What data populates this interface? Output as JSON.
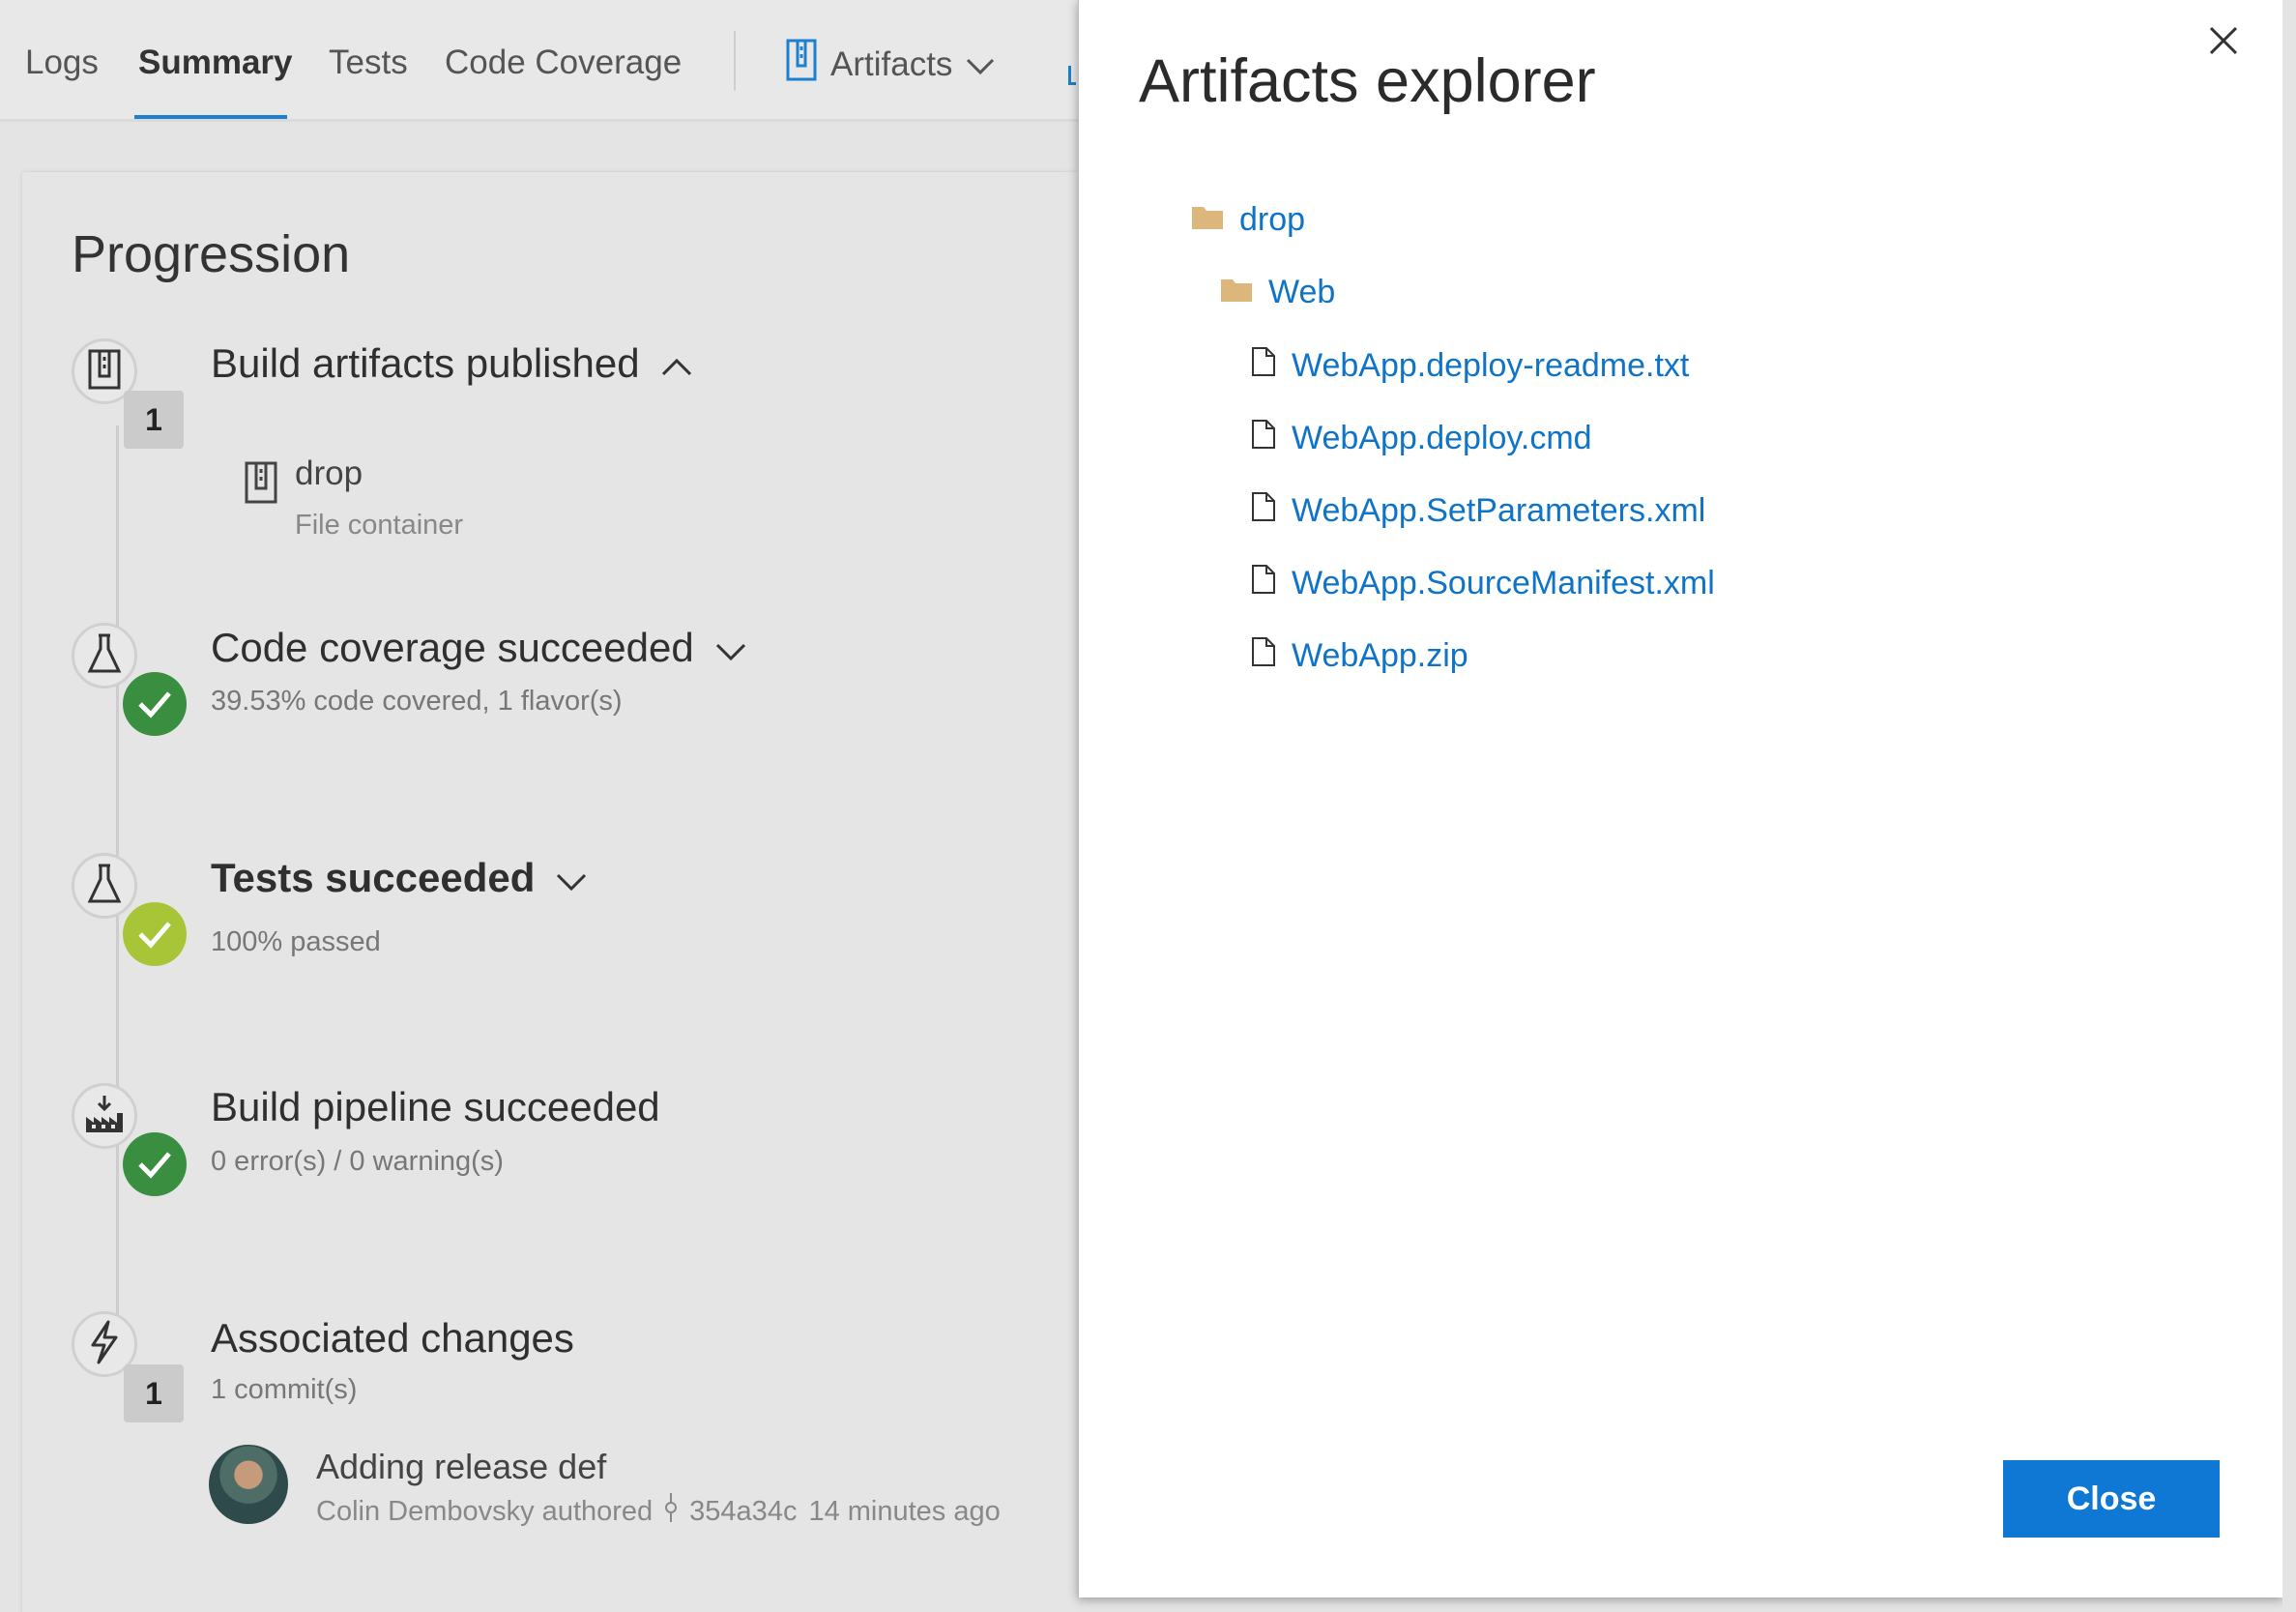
{
  "tabs": [
    {
      "label": "Logs"
    },
    {
      "label": "Summary"
    },
    {
      "label": "Tests"
    },
    {
      "label": "Code Coverage"
    }
  ],
  "artifacts_tab": {
    "label": "Artifacts"
  },
  "progression": {
    "title": "Progression",
    "steps": [
      {
        "title": "Build artifacts published",
        "badge": "1",
        "icon": "zip-archive-icon",
        "chevron": "up"
      },
      {
        "title": "Code coverage succeeded",
        "subtitle": "39.53% code covered, 1 flavor(s)",
        "icon": "flask-icon",
        "status": "success",
        "chevron": "down"
      },
      {
        "title": "Tests succeeded",
        "subtitle": "100% passed",
        "icon": "flask-icon",
        "status": "success-partial",
        "chevron": "down"
      },
      {
        "title": "Build pipeline succeeded",
        "subtitle": "0 error(s) / 0 warning(s)",
        "icon": "factory-icon",
        "status": "success"
      },
      {
        "title": "Associated changes",
        "subtitle": "1 commit(s)",
        "badge": "1",
        "icon": "lightning-icon"
      }
    ],
    "artifact_item": {
      "name": "drop",
      "type": "File container"
    },
    "commit": {
      "message": "Adding release def",
      "author": "Colin Dembovsky authored",
      "hash": "354a34c",
      "time": "14 minutes ago"
    }
  },
  "panel": {
    "title": "Artifacts explorer",
    "tree": {
      "root": "drop",
      "folder": "Web",
      "files": [
        "WebApp.deploy-readme.txt",
        "WebApp.deploy.cmd",
        "WebApp.SetParameters.xml",
        "WebApp.SourceManifest.xml",
        "WebApp.zip"
      ]
    },
    "close_label": "Close"
  },
  "colors": {
    "accent": "#0f78d4",
    "link": "#0f73c7",
    "success": "#3a8e3f",
    "success_light": "#a7c536",
    "folder": "#dcb67a"
  }
}
